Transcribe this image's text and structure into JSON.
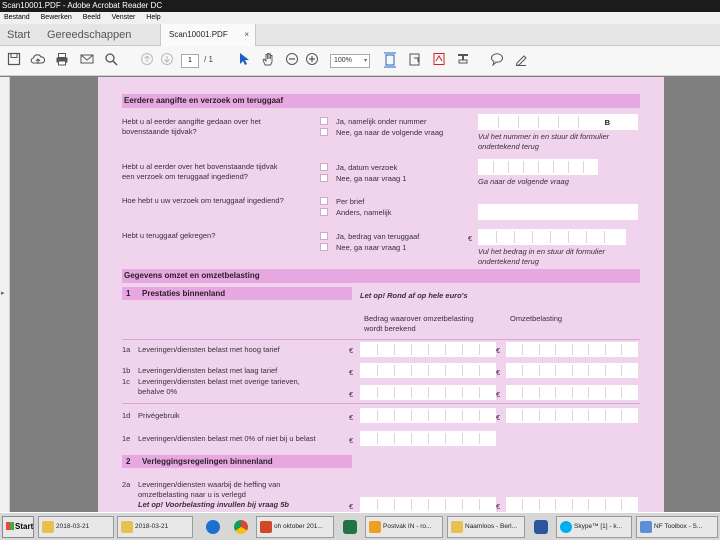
{
  "window": {
    "title": "Scan10001.PDF - Adobe Acrobat Reader DC"
  },
  "menu": [
    "Bestand",
    "Bewerken",
    "Beeld",
    "Venster",
    "Help"
  ],
  "tabs": {
    "start": "Start",
    "tools": "Gereedschappen",
    "document": "Scan10001.PDF",
    "close": "×"
  },
  "toolbar": {
    "page_current": "1",
    "page_total": "/ 1",
    "zoom": "100%",
    "zoom_arrow": "▾"
  },
  "leftpane": {
    "expand": "▸"
  },
  "form": {
    "sec1_title": "Eerdere aangifte en verzoek om teruggaaf",
    "q1a": "Hebt u al eerder aangifte gedaan over het",
    "q1b": "bovenstaande tijdvak?",
    "q1_opt1": "Ja, namelijk onder nummer",
    "q1_opt2": "Nee, ga naar de volgende vraag",
    "q1_box": "B",
    "q1_note1": "Vul het nummer in en stuur dit formulier",
    "q1_note2": "ondertekend terug",
    "q2a": "Hebt u al eerder over het bovenstaande tijdvak",
    "q2b": "een verzoek om teruggaaf ingediend?",
    "q2_opt1": "Ja, datum verzoek",
    "q2_opt2": "Nee, ga naar vraag 1",
    "q2_note": "Ga naar de volgende vraag",
    "q3": "Hoe hebt u uw verzoek om teruggaaf ingediend?",
    "q3_opt1": "Per brief",
    "q3_opt2": "Anders, namelijk",
    "q4": "Hebt u teruggaaf gekregen?",
    "q4_opt1": "Ja, bedrag van teruggaaf",
    "q4_opt2": "Nee, ga naar vraag 1",
    "q4_euro": "€",
    "q4_note1": "Vul het bedrag in en stuur dit formulier",
    "q4_note2": "ondertekend terug",
    "sec2_title": "Gegevens omzet en omzetbelasting",
    "sub1_num": "1",
    "sub1_title": "Prestaties binnenland",
    "letop": "Let op! Rond af op hele euro's",
    "col1a": "Bedrag waarover omzetbelasting",
    "col1b": "wordt berekend",
    "col2": "Omzetbelasting",
    "r1a_num": "1a",
    "r1a": "Leveringen/diensten belast met hoog tarief",
    "r1b_num": "1b",
    "r1b": "Leveringen/diensten belast met laag tarief",
    "r1c_num": "1c",
    "r1c_a": "Leveringen/diensten belast met overige tarieven,",
    "r1c_b": "behalve 0%",
    "r1d_num": "1d",
    "r1d": "Privégebruik",
    "r1e_num": "1e",
    "r1e": "Leveringen/diensten belast met 0% of niet bij u belast",
    "euro": "€",
    "sub2_num": "2",
    "sub2_title": "Verleggingsregelingen binnenland",
    "r2a_num": "2a",
    "r2a_a": "Leveringen/diensten waarbij de heffing van",
    "r2a_b": "omzetbelasting naar u is verlegd",
    "r2a_c": "Let op! Voorbelasting invullen bij vraag 5b"
  },
  "taskbar": {
    "start": "Start",
    "items": [
      "2018-03-21",
      "2018-03-21",
      "oh oktober 201...",
      "Postvak IN - ro...",
      "Naamloos - Berl...",
      "Skype™ [1] - k...",
      "NF Toolbox - S..."
    ]
  },
  "colors": {
    "form_bg": "#f0d3ec",
    "header_band": "#e7a7e0",
    "acrobat_red": "#d4202a"
  }
}
